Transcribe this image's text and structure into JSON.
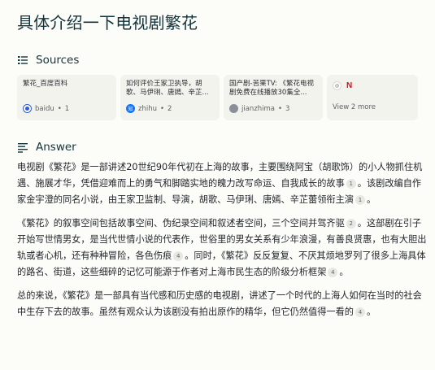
{
  "page": {
    "title": "具体介绍一下电视剧繁花"
  },
  "sources": {
    "heading": "Sources",
    "items": [
      {
        "title": "繁花_百度百科",
        "site": "baidu",
        "index": "1",
        "favicon": "baidu-icon"
      },
      {
        "title": "如何评价王家卫执导，胡歌、马伊琍、唐嫣、辛芷...",
        "site": "zhihu",
        "index": "2",
        "favicon": "zhihu-icon"
      },
      {
        "title": "国产剧-苦果TV: 《繁花电视剧免费在线播放30集全...",
        "site": "jianzhima",
        "index": "3",
        "favicon": "jianzhima-icon"
      }
    ],
    "more": {
      "label": "View 2 more",
      "icons": [
        "generic-site-icon",
        "netflix-icon"
      ]
    }
  },
  "answer": {
    "heading": "Answer",
    "paragraphs": [
      [
        {
          "text": "电视剧《繁花》是一部讲述20世纪90年代初在上海的故事，主要围绕阿宝（胡歌饰）的小人物抓住机遇、施展才华，凭借迎难而上的勇气和脚踏实地的魄力改写命运、自我成长的故事"
        },
        {
          "cite": "1"
        },
        {
          "text": "。该剧改编自作家金宇澄的同名小说，由王家卫监制、导演，胡歌、马伊琍、唐嫣、辛芷蕾领衔主演"
        },
        {
          "cite": "1"
        },
        {
          "text": "。"
        }
      ],
      [
        {
          "text": "《繁花》的叙事空间包括故事空间、伪纪录空间和叙述者空间，三个空间并驾齐驱"
        },
        {
          "cite": "2"
        },
        {
          "text": "。这部剧在引子开始写世情男女，是当代世情小说的代表作，世俗里的男女关系有少年浪漫，有善良贤惠，也有大胆出轨或者心机，还有种种冒险，各色伤痕"
        },
        {
          "cite": "4"
        },
        {
          "text": "。同时，《繁花》反反复复、不厌其烦地罗列了很多上海具体的路名、街道，这些细碎的记忆可能源于作者对上海市民生态的阶级分析框架"
        },
        {
          "cite": "4"
        },
        {
          "text": "。"
        }
      ],
      [
        {
          "text": "总的来说，《繁花》是一部具有当代感和历史感的电视剧，讲述了一个时代的上海人如何在当时的社会中生存下去的故事。虽然有观众认为该剧没有拍出原作的精华，但它仍然值得一看的"
        },
        {
          "cite": "4"
        },
        {
          "text": "。"
        }
      ]
    ]
  }
}
